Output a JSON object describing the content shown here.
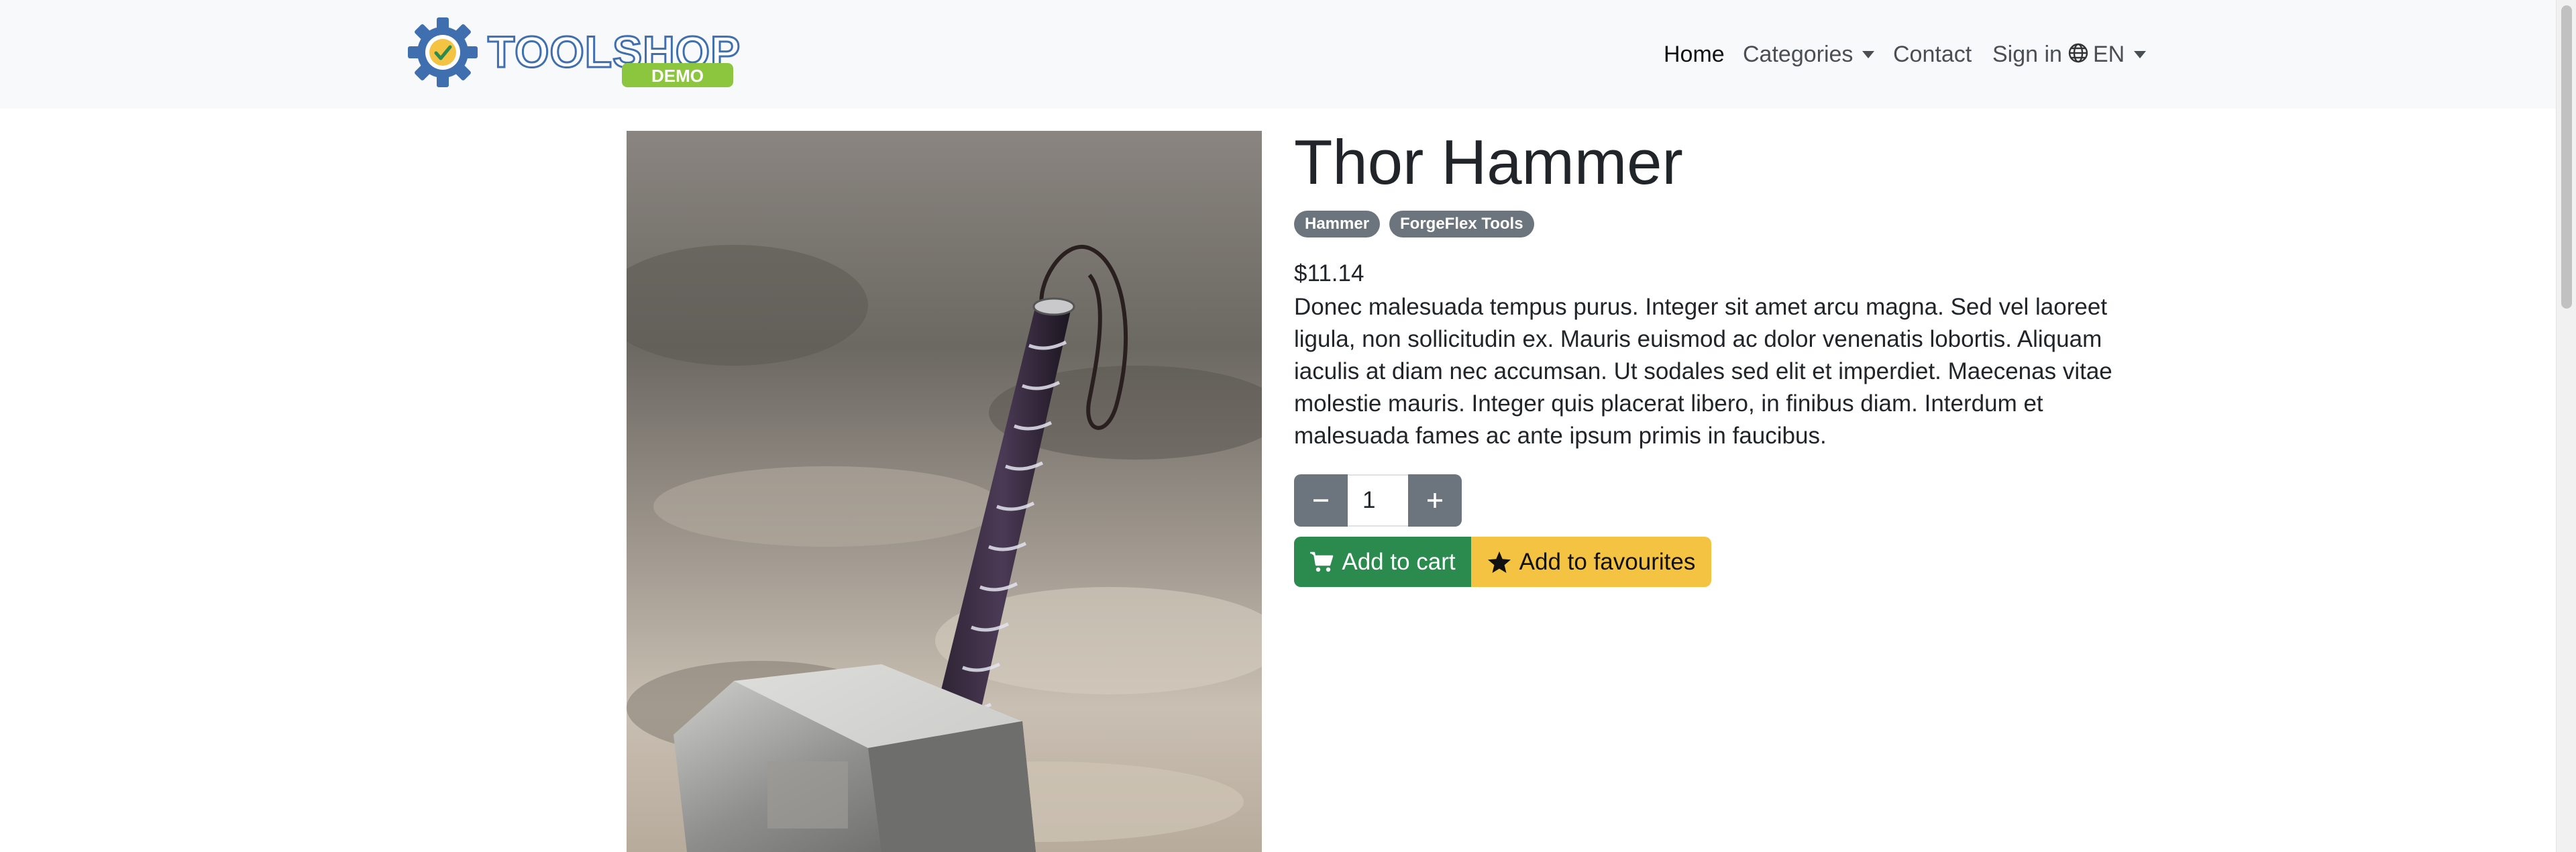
{
  "brand": {
    "logo_text": "TOOLSHOP",
    "logo_badge": "DEMO",
    "logo_icon": "gear-check-icon"
  },
  "nav": {
    "home": "Home",
    "categories": "Categories",
    "contact": "Contact",
    "sign_in": "Sign in",
    "language": "EN",
    "language_icon": "globe-icon"
  },
  "product": {
    "name": "Thor Hammer",
    "category_badge": "Hammer",
    "brand_badge": "ForgeFlex Tools",
    "price": "$11.14",
    "description": "Donec malesuada tempus purus. Integer sit amet arcu magna. Sed vel laoreet ligula, non sollicitudin ex. Mauris euismod ac dolor venenatis lobortis. Aliquam iaculis at diam nec accumsan. Ut sodales sed elit et imperdiet. Maecenas vitae molestie mauris. Integer quis placerat libero, in finibus diam. Interdum et malesuada fames ac ante ipsum primis in faucibus.",
    "quantity": "1"
  },
  "actions": {
    "add_to_cart": "Add to cart",
    "add_to_favourites": "Add to favourites",
    "cart_icon": "cart-icon",
    "favourite_icon": "star-icon"
  },
  "colors": {
    "navbar_bg": "#f8f9fa",
    "badge_bg": "#6c757d",
    "cart_button": "#2b8a4e",
    "favourite_button": "#f5c342",
    "logo_blue": "#3f6fae",
    "logo_green": "#8cc63f"
  }
}
